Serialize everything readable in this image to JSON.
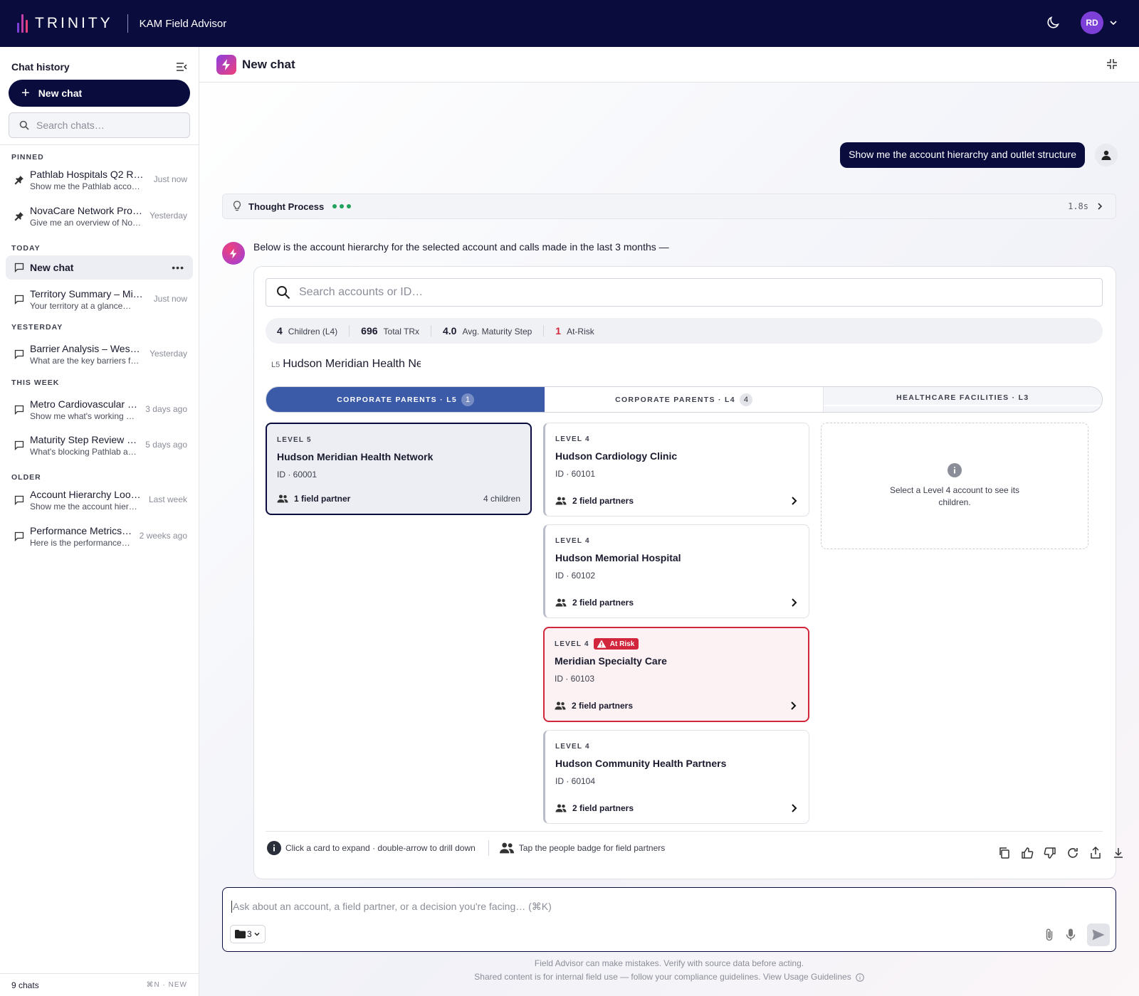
{
  "topbar": {
    "logo_text": "TRINITY",
    "app_title": "KAM Field Advisor",
    "avatar_initials": "RD",
    "logo_colors": [
      "#7c3fd8",
      "#c23fa8",
      "#e8417a"
    ]
  },
  "sidebar": {
    "title": "Chat history",
    "new_chat_label": "New chat",
    "search_placeholder": "Search chats…",
    "sections": {
      "pinned": "PINNED",
      "today": "TODAY",
      "yesterday": "YESTERDAY",
      "this_week": "THIS WEEK",
      "older": "OLDER"
    },
    "pinned": [
      {
        "title": "Pathlab Hospitals Q2 R…",
        "sub": "Show me the Pathlab accou…",
        "time": "Just now"
      },
      {
        "title": "NovaCare Network Pro…",
        "sub": "Give me an overview of No…",
        "time": "Yesterday"
      }
    ],
    "active": {
      "title": "New chat",
      "menu": "•••"
    },
    "today": [
      {
        "title": "Territory Summary – Mi…",
        "sub": "Your territory at a glance…",
        "time": "Just now"
      }
    ],
    "yesterday": [
      {
        "title": "Barrier Analysis – Wes…",
        "sub": "What are the key barriers f…",
        "time": "Yesterday"
      }
    ],
    "this_week": [
      {
        "title": "Metro Cardiovascular …",
        "sub": "Show me what's working …",
        "time": "3 days ago"
      },
      {
        "title": "Maturity Step Review …",
        "sub": "What's blocking Pathlab a…",
        "time": "5 days ago"
      }
    ],
    "older": [
      {
        "title": "Account Hierarchy Loo…",
        "sub": "Show me the account hier…",
        "time": "Last week"
      },
      {
        "title": "Performance Metrics…",
        "sub": "Here is the performance…",
        "time": "2 weeks ago"
      }
    ],
    "footer_count": "9 chats",
    "footer_shortcut": "⌘N · NEW"
  },
  "main": {
    "title": "New chat",
    "user_message": "Show me the account hierarchy and outlet structure",
    "thought": {
      "label": "Thought Process",
      "time": "1.8s"
    },
    "intro": "Below is the account hierarchy for the selected account and calls made in the last 3 months —",
    "card": {
      "search_placeholder": "Search accounts or ID…",
      "stats": [
        {
          "value": "4",
          "label": "Children (L4)"
        },
        {
          "value": "696",
          "label": "Total TRx"
        },
        {
          "value": "4.0",
          "label": "Avg. Maturity Step"
        },
        {
          "value": "1",
          "label": "At-Risk"
        }
      ],
      "breadcrumb": {
        "level": "L5",
        "name": "Hudson Meridian Health Network"
      },
      "tabs": [
        {
          "label": "CORPORATE PARENTS · L5",
          "count": "1"
        },
        {
          "label": "CORPORATE PARENTS · L4",
          "count": "4"
        },
        {
          "label": "HEALTHCARE FACILITIES · L3",
          "count": ""
        }
      ],
      "l5": {
        "level": "LEVEL 5",
        "name": "Hudson Meridian Health Network",
        "id": "ID · 60001",
        "partners": "1 field partner",
        "children": "4 children"
      },
      "l4": [
        {
          "level": "LEVEL 4",
          "name": "Hudson Cardiology Clinic",
          "id": "ID · 60101",
          "partners": "2 field partners"
        },
        {
          "level": "LEVEL 4",
          "name": "Hudson Memorial Hospital",
          "id": "ID · 60102",
          "partners": "2 field partners"
        },
        {
          "level": "LEVEL 4",
          "name": "Meridian Specialty Care",
          "id": "ID · 60103",
          "partners": "2 field partners",
          "badge": "At Risk"
        },
        {
          "level": "LEVEL 4",
          "name": "Hudson Community Health Partners",
          "id": "ID · 60104",
          "partners": "2 field partners"
        }
      ],
      "empty_text": "Select a Level 4 account to see its children.",
      "hint1": "Click a card to expand · double-arrow to drill down",
      "hint2": "Tap the people badge for field partners"
    },
    "composer": {
      "placeholder": "Ask about an account, a field partner, or a decision you're facing…  (⌘K)",
      "folder_count": "3"
    },
    "disclaimer_1": "Field Advisor can make mistakes. Verify with source data before acting.",
    "disclaimer_2": "Shared content is for internal field use — follow your compliance guidelines. View Usage Guidelines"
  }
}
